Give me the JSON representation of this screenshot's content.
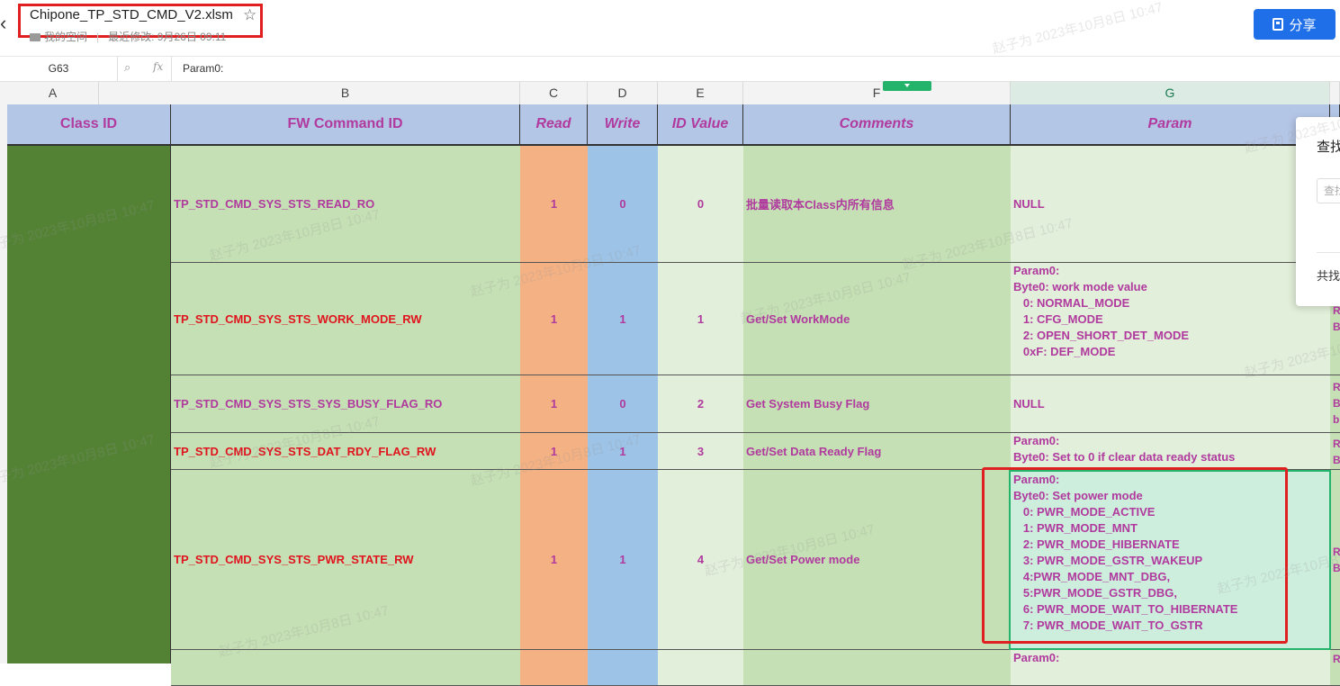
{
  "doc": {
    "filename": "Chipone_TP_STD_CMD_V2.xlsm",
    "location": "我的空间",
    "modified": "最近修改: 9月26日 09:11",
    "share_label": "分享"
  },
  "formula": {
    "cell_ref": "G63",
    "fx": "fx",
    "content": "Param0:"
  },
  "columns": [
    "A",
    "B",
    "C",
    "D",
    "E",
    "F",
    "G"
  ],
  "selected_column": "G",
  "header": {
    "class_id": "Class ID",
    "fw_cmd": "FW Command ID",
    "read": "Read",
    "write": "Write",
    "id_value": "ID Value",
    "comments": "Comments",
    "param": "Param"
  },
  "rows": [
    {
      "cmd": "TP_STD_CMD_SYS_STS_READ_RO",
      "read": "1",
      "write": "0",
      "id": "0",
      "comment": "批量读取本Class内所有信息",
      "param": "NULL",
      "red": false
    },
    {
      "cmd": "TP_STD_CMD_SYS_STS_WORK_MODE_RW",
      "read": "1",
      "write": "1",
      "id": "1",
      "comment": "Get/Set WorkMode",
      "param": "Param0:\nByte0: work mode value\n   0: NORMAL_MODE\n   1: CFG_MODE\n   2: OPEN_SHORT_DET_MODE\n   0xF: DEF_MODE",
      "red": true
    },
    {
      "cmd": "TP_STD_CMD_SYS_STS_SYS_BUSY_FLAG_RO",
      "read": "1",
      "write": "0",
      "id": "2",
      "comment": "Get System Busy Flag",
      "param": "NULL",
      "red": false
    },
    {
      "cmd": "TP_STD_CMD_SYS_STS_DAT_RDY_FLAG_RW",
      "read": "1",
      "write": "1",
      "id": "3",
      "comment": "Get/Set Data Ready Flag",
      "param": "Param0:\nByte0: Set to 0 if clear data ready status",
      "red": true
    },
    {
      "cmd": "TP_STD_CMD_SYS_STS_PWR_STATE_RW",
      "read": "1",
      "write": "1",
      "id": "4",
      "comment": "Get/Set Power mode",
      "param": "Param0:\nByte0: Set power mode\n   0: PWR_MODE_ACTIVE\n   1: PWR_MODE_MNT\n   2: PWR_MODE_HIBERNATE\n   3: PWR_MODE_GSTR_WAKEUP\n   4:PWR_MODE_MNT_DBG,\n   5:PWR_MODE_GSTR_DBG,\n   6: PWR_MODE_WAIT_TO_HIBERNATE\n   7: PWR_MODE_WAIT_TO_GSTR",
      "red": true
    },
    {
      "cmd": "",
      "read": "",
      "write": "",
      "id": "",
      "comment": "",
      "param": "Param0:",
      "red": false
    }
  ],
  "right_col_fragments": [
    "R",
    "B",
    "R",
    "B",
    "b",
    "R",
    "B",
    "R",
    "B",
    "R"
  ],
  "find_panel": {
    "title": "查找",
    "input_placeholder": "查找",
    "count": "共找"
  },
  "watermark": "赵子为 2023年10月8日 10:47"
}
